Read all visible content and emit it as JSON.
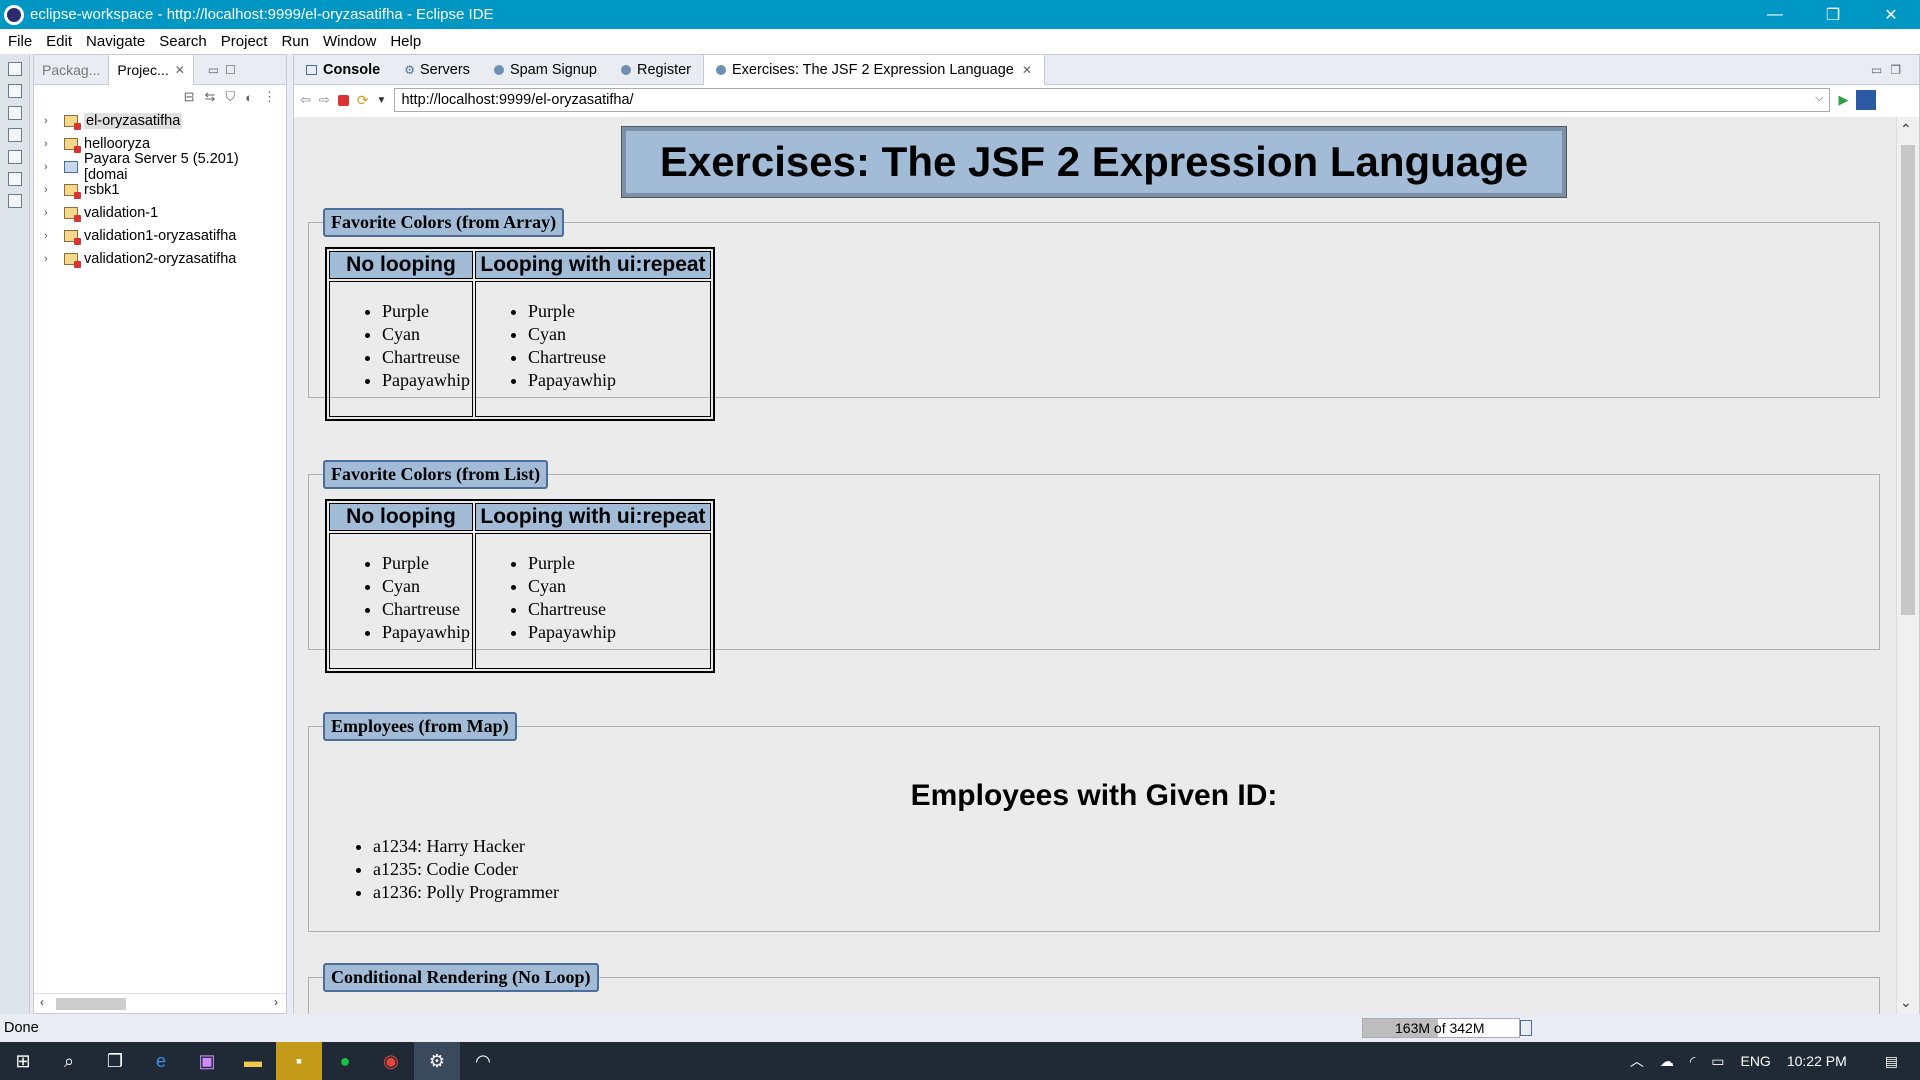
{
  "window": {
    "title": "eclipse-workspace - http://localhost:9999/el-oryzasatifha - Eclipse IDE",
    "minimize": "—",
    "restore": "❐",
    "close": "✕"
  },
  "menu": [
    "File",
    "Edit",
    "Navigate",
    "Search",
    "Project",
    "Run",
    "Window",
    "Help"
  ],
  "explorer": {
    "tabs": [
      {
        "label": "Packag..."
      },
      {
        "label": "Projec...",
        "close": "✕"
      }
    ],
    "items": [
      {
        "label": "el-oryzasatifha",
        "selected": true
      },
      {
        "label": "hellooryza"
      },
      {
        "label": "Payara Server 5 (5.201) [domai",
        "server": true
      },
      {
        "label": "rsbk1"
      },
      {
        "label": "validation-1"
      },
      {
        "label": "validation1-oryzasatifha"
      },
      {
        "label": "validation2-oryzasatifha"
      }
    ]
  },
  "editor": {
    "tabs": [
      {
        "label": "Console",
        "bold": true
      },
      {
        "label": "Servers"
      },
      {
        "label": "Spam Signup"
      },
      {
        "label": "Register"
      },
      {
        "label": "Exercises: The JSF 2 Expression Language",
        "active": true,
        "close": "✕"
      }
    ],
    "url": "http://localhost:9999/el-oryzasatifha/"
  },
  "page": {
    "title": "Exercises: The JSF 2 Expression Language",
    "sections": {
      "array": {
        "legend": "Favorite Colors (from Array)",
        "col1": "No looping",
        "col2": "Looping with ui:repeat",
        "colors": [
          "Purple",
          "Cyan",
          "Chartreuse",
          "Papayawhip"
        ]
      },
      "list": {
        "legend": "Favorite Colors (from List)",
        "col1": "No looping",
        "col2": "Looping with ui:repeat",
        "colors": [
          "Purple",
          "Cyan",
          "Chartreuse",
          "Papayawhip"
        ]
      },
      "map": {
        "legend": "Employees (from Map)",
        "heading": "Employees with Given ID:",
        "employees": [
          "a1234: Harry Hacker",
          "a1235: Codie Coder",
          "a1236: Polly Programmer"
        ]
      },
      "conditional": {
        "legend": "Conditional Rendering (No Loop)"
      }
    }
  },
  "status": {
    "text": "Done",
    "heap": "163M of 342M",
    "heap_used_fraction": 0.48
  },
  "taskbar": {
    "lang": "ENG",
    "time": "10:22 PM"
  }
}
